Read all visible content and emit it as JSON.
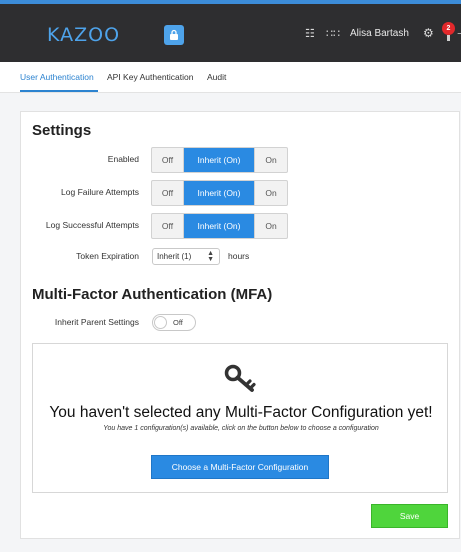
{
  "topbar": {
    "logo": "KAZOO",
    "user_name": "Alisa Bartash",
    "notification_count": "2",
    "accent_color": "#3c8cd8"
  },
  "tabs": [
    {
      "label": "User Authentication",
      "active": true
    },
    {
      "label": "API Key Authentication",
      "active": false
    },
    {
      "label": "Audit",
      "active": false
    }
  ],
  "settings": {
    "title": "Settings",
    "rows": [
      {
        "label": "Enabled",
        "options": [
          "Off",
          "Inherit (On)",
          "On"
        ],
        "selected": "Inherit (On)"
      },
      {
        "label": "Log Failure Attempts",
        "options": [
          "Off",
          "Inherit (On)",
          "On"
        ],
        "selected": "Inherit (On)"
      },
      {
        "label": "Log Successful Attempts",
        "options": [
          "Off",
          "Inherit (On)",
          "On"
        ],
        "selected": "Inherit (On)"
      }
    ],
    "token_expiration": {
      "label": "Token Expiration",
      "value": "Inherit (1)",
      "unit": "hours"
    }
  },
  "mfa": {
    "title": "Multi-Factor Authentication (MFA)",
    "inherit_label": "Inherit Parent Settings",
    "inherit_toggle": "Off",
    "empty_heading": "You haven't selected any Multi-Factor Configuration yet!",
    "empty_sub": "You have 1 configuration(s) available, click on the button below to choose a configuration",
    "choose_button": "Choose a Multi-Factor Configuration"
  },
  "save_button": "Save",
  "colors": {
    "primary": "#2a8ae2",
    "save": "#4fd53c",
    "notification": "#e2282b"
  }
}
